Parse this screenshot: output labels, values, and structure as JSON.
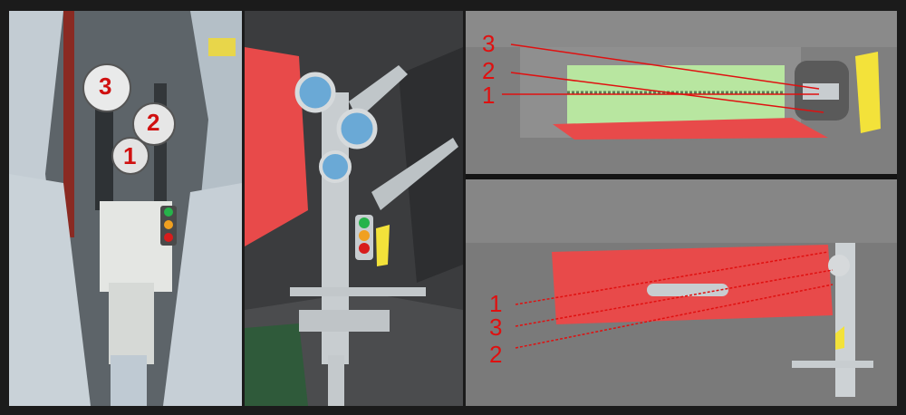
{
  "photo_panel": {
    "badges": [
      "3",
      "2",
      "1"
    ]
  },
  "top_right_panel": {
    "labels": [
      "3",
      "2",
      "1"
    ]
  },
  "bottom_right_panel": {
    "labels": [
      "1",
      "3",
      "2"
    ]
  },
  "colors": {
    "callout_red": "#e01010",
    "door_red": "#e84a4a",
    "strut_gray": "#c8cdd0",
    "lamp_blue": "#6aa9d6",
    "light_green": "#26b34a",
    "light_amber": "#f0a020",
    "light_red": "#d81c1c",
    "bay_green": "#b8e6a0",
    "bracket_yellow": "#f3e23a"
  }
}
